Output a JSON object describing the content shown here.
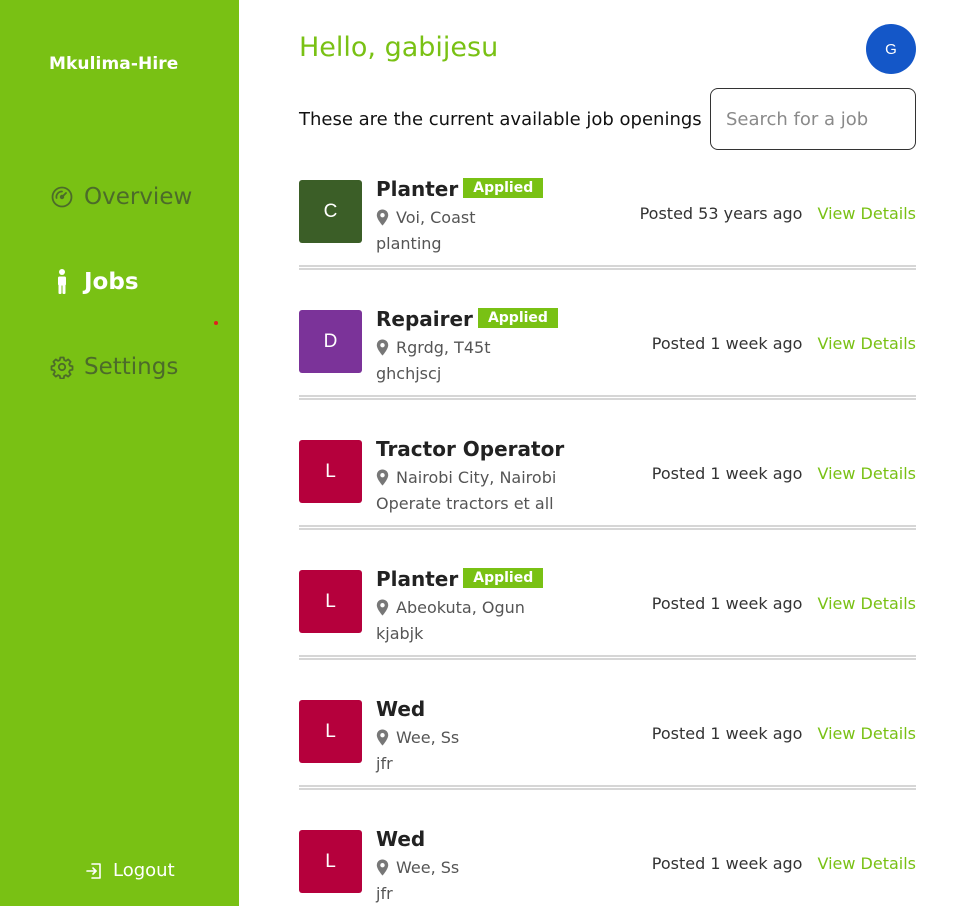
{
  "app": {
    "brand": "Mkulima-Hire"
  },
  "sidebar": {
    "items": [
      {
        "label": "Overview",
        "icon": "gauge-icon",
        "active": false
      },
      {
        "label": "Jobs",
        "icon": "person-icon",
        "active": true
      },
      {
        "label": "Settings",
        "icon": "gear-icon",
        "active": false
      }
    ],
    "logout_label": "Logout"
  },
  "header": {
    "greeting": "Hello, gabijesu",
    "avatar_initial": "G",
    "subtitle": "These are the current available job openings"
  },
  "search": {
    "placeholder": "Search for a job",
    "value": ""
  },
  "colors": {
    "accent": "#79c114",
    "avatar": "#1457c8",
    "logo_c": "#3b5e27",
    "logo_d": "#7b3399",
    "logo_l": "#b5003c"
  },
  "jobs": [
    {
      "initial": "C",
      "logo_color": "#3b5e27",
      "title": "Planter",
      "badge": "Applied",
      "location": "Voi, Coast",
      "description": "planting",
      "posted": "Posted 53 years ago",
      "action": "View Details"
    },
    {
      "initial": "D",
      "logo_color": "#7b3399",
      "title": "Repairer",
      "badge": "Applied",
      "location": "Rgrdg, T45t",
      "description": "ghchjscj",
      "posted": "Posted 1 week ago",
      "action": "View Details"
    },
    {
      "initial": "L",
      "logo_color": "#b5003c",
      "title": "Tractor Operator",
      "badge": "",
      "location": "Nairobi City, Nairobi",
      "description": "Operate tractors et all",
      "posted": "Posted 1 week ago",
      "action": "View Details"
    },
    {
      "initial": "L",
      "logo_color": "#b5003c",
      "title": "Planter",
      "badge": "Applied",
      "location": "Abeokuta, Ogun",
      "description": "kjabjk",
      "posted": "Posted 1 week ago",
      "action": "View Details"
    },
    {
      "initial": "L",
      "logo_color": "#b5003c",
      "title": "Wed",
      "badge": "",
      "location": "Wee, Ss",
      "description": "jfr",
      "posted": "Posted 1 week ago",
      "action": "View Details"
    },
    {
      "initial": "L",
      "logo_color": "#b5003c",
      "title": "Wed",
      "badge": "",
      "location": "Wee, Ss",
      "description": "jfr",
      "posted": "Posted 1 week ago",
      "action": "View Details"
    }
  ]
}
